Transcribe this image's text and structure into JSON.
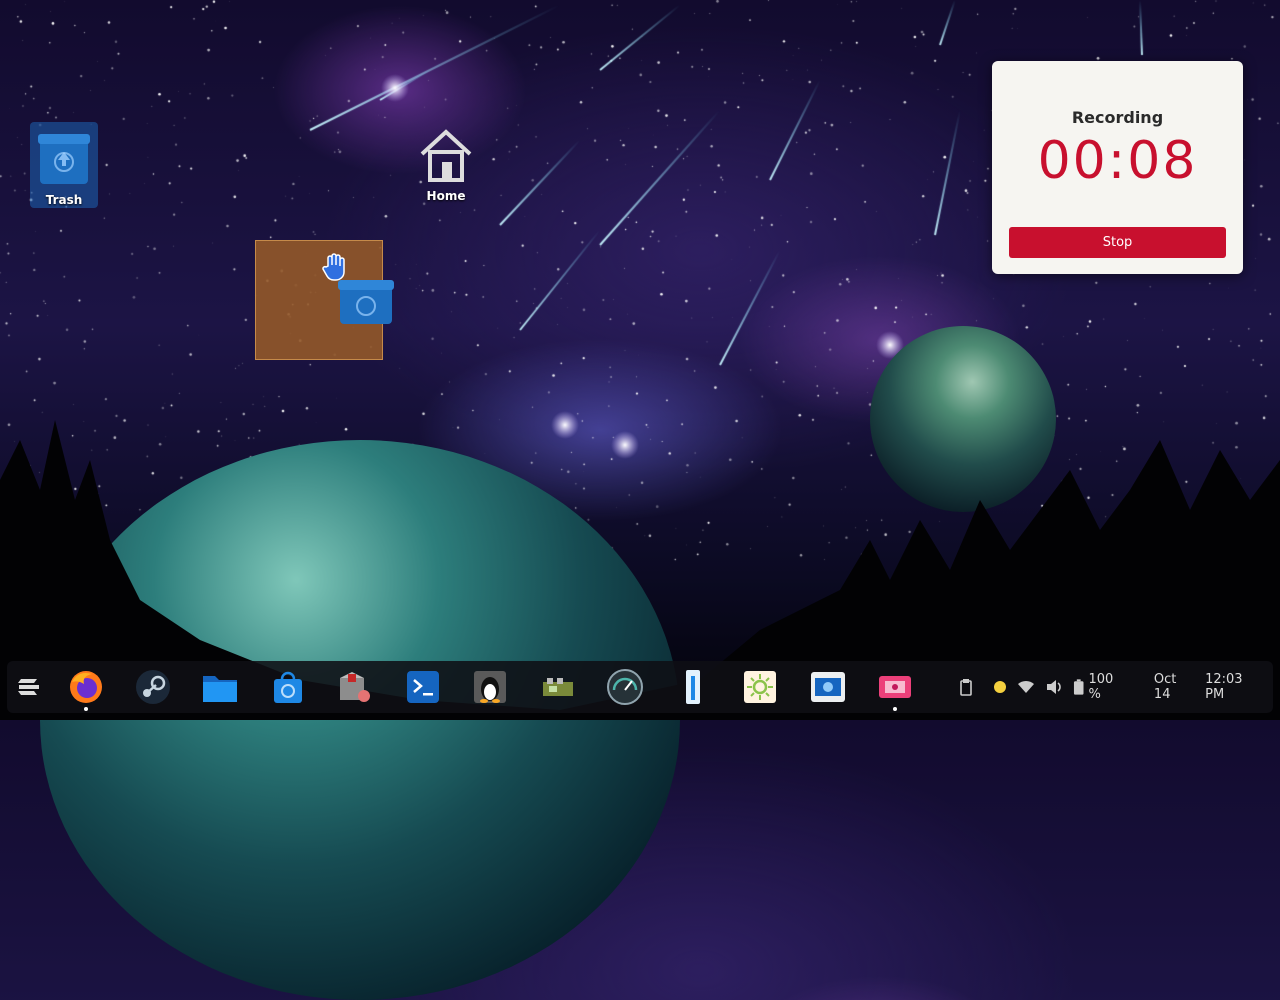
{
  "desktop": {
    "trash_label": "Trash",
    "home_label": "Home"
  },
  "recording": {
    "title": "Recording",
    "time": "00:08",
    "stop_label": "Stop",
    "accent": "#c8102e"
  },
  "taskbar": {
    "apps": [
      {
        "name": "zorin-menu-icon"
      },
      {
        "name": "firefox-icon"
      },
      {
        "name": "steam-icon"
      },
      {
        "name": "files-icon"
      },
      {
        "name": "software-store-icon"
      },
      {
        "name": "package-installer-icon"
      },
      {
        "name": "terminal-icon"
      },
      {
        "name": "linux-tux-icon"
      },
      {
        "name": "hardware-tool-icon"
      },
      {
        "name": "system-monitor-gauge-icon"
      },
      {
        "name": "thermometer-icon"
      },
      {
        "name": "brightness-icon"
      },
      {
        "name": "screenshot-icon"
      },
      {
        "name": "screen-recorder-icon"
      }
    ],
    "tray": {
      "battery_percent": "100 %",
      "date": "Oct 14",
      "time": "12:03 PM"
    }
  }
}
